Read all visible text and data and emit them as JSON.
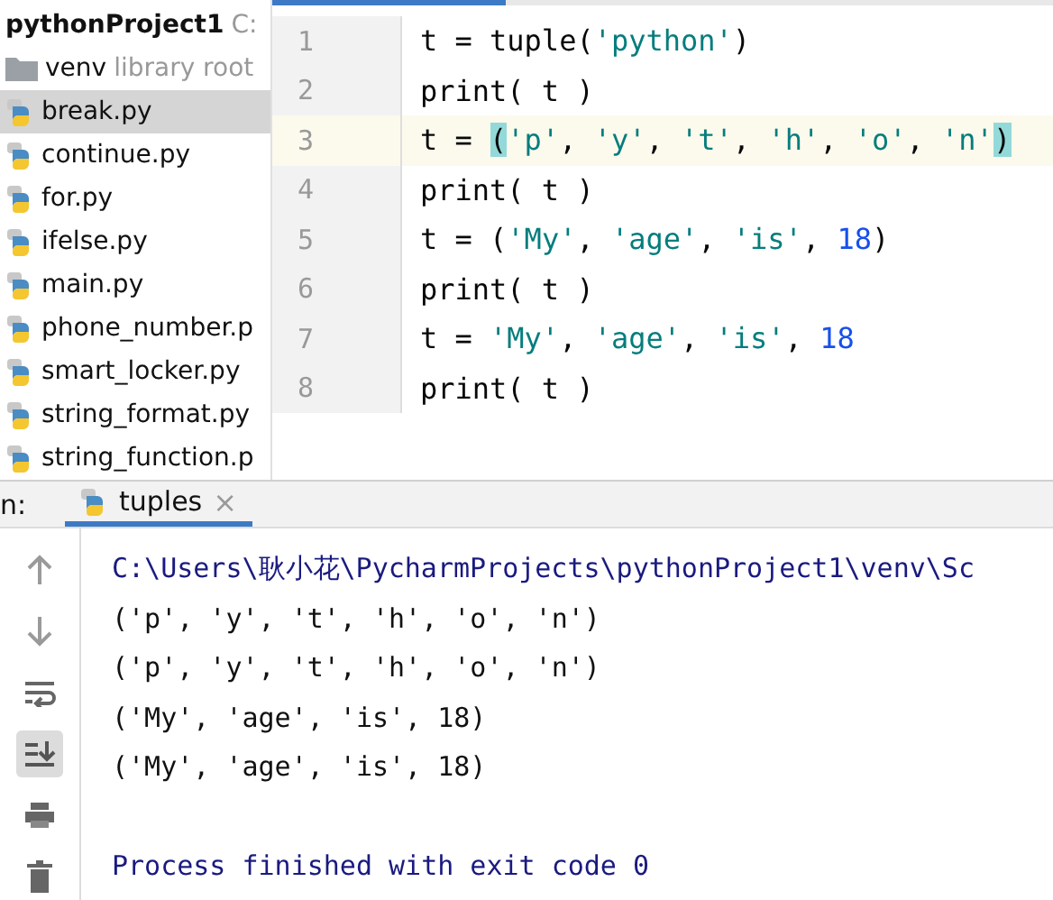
{
  "project": {
    "root": {
      "name": "pythonProject1",
      "path": "C:"
    },
    "items": [
      {
        "kind": "folder",
        "name": "venv",
        "note": "library root",
        "selected": false
      },
      {
        "kind": "file",
        "name": "break.py",
        "selected": true
      },
      {
        "kind": "file",
        "name": "continue.py",
        "selected": false
      },
      {
        "kind": "file",
        "name": "for.py",
        "selected": false
      },
      {
        "kind": "file",
        "name": "ifelse.py",
        "selected": false
      },
      {
        "kind": "file",
        "name": "main.py",
        "selected": false
      },
      {
        "kind": "file",
        "name": "phone_number.p",
        "selected": false
      },
      {
        "kind": "file",
        "name": "smart_locker.py",
        "selected": false
      },
      {
        "kind": "file",
        "name": "string_format.py",
        "selected": false
      },
      {
        "kind": "file",
        "name": "string_function.p",
        "selected": false
      }
    ]
  },
  "editor": {
    "lines": [
      {
        "number": "1",
        "current": false,
        "tokens": [
          {
            "kind": "plain",
            "text": "t = tuple("
          },
          {
            "kind": "string",
            "text": "'python'"
          },
          {
            "kind": "plain",
            "text": ")"
          }
        ]
      },
      {
        "number": "2",
        "current": false,
        "tokens": [
          {
            "kind": "plain",
            "text": "print( t )"
          }
        ]
      },
      {
        "number": "3",
        "current": true,
        "tokens": [
          {
            "kind": "plain",
            "text": "t = "
          },
          {
            "kind": "match",
            "text": "("
          },
          {
            "kind": "string",
            "text": "'p'"
          },
          {
            "kind": "plain",
            "text": ", "
          },
          {
            "kind": "string",
            "text": "'y'"
          },
          {
            "kind": "plain",
            "text": ", "
          },
          {
            "kind": "string",
            "text": "'t'"
          },
          {
            "kind": "plain",
            "text": ", "
          },
          {
            "kind": "string",
            "text": "'h'"
          },
          {
            "kind": "plain",
            "text": ", "
          },
          {
            "kind": "string",
            "text": "'o'"
          },
          {
            "kind": "plain",
            "text": ", "
          },
          {
            "kind": "string",
            "text": "'n'"
          },
          {
            "kind": "match",
            "text": ")"
          }
        ]
      },
      {
        "number": "4",
        "current": false,
        "tokens": [
          {
            "kind": "plain",
            "text": "print( t )"
          }
        ]
      },
      {
        "number": "5",
        "current": false,
        "tokens": [
          {
            "kind": "plain",
            "text": "t = ("
          },
          {
            "kind": "string",
            "text": "'My'"
          },
          {
            "kind": "plain",
            "text": ", "
          },
          {
            "kind": "string",
            "text": "'age'"
          },
          {
            "kind": "plain",
            "text": ", "
          },
          {
            "kind": "string",
            "text": "'is'"
          },
          {
            "kind": "plain",
            "text": ", "
          },
          {
            "kind": "number",
            "text": "18"
          },
          {
            "kind": "plain",
            "text": ")"
          }
        ]
      },
      {
        "number": "6",
        "current": false,
        "tokens": [
          {
            "kind": "plain",
            "text": "print( t )"
          }
        ]
      },
      {
        "number": "7",
        "current": false,
        "tokens": [
          {
            "kind": "plain",
            "text": "t = "
          },
          {
            "kind": "string",
            "text": "'My'"
          },
          {
            "kind": "plain",
            "text": ", "
          },
          {
            "kind": "string",
            "text": "'age'"
          },
          {
            "kind": "plain",
            "text": ", "
          },
          {
            "kind": "string",
            "text": "'is'"
          },
          {
            "kind": "plain",
            "text": ", "
          },
          {
            "kind": "number",
            "text": "18"
          }
        ]
      },
      {
        "number": "8",
        "current": false,
        "tokens": [
          {
            "kind": "plain",
            "text": "print( t )"
          }
        ]
      }
    ]
  },
  "run": {
    "label": "n:",
    "tabs": [
      {
        "title": "tuples",
        "close": "×",
        "selected": true
      }
    ],
    "output": [
      {
        "kind": "command",
        "text": "C:\\Users\\耿小花\\PycharmProjects\\pythonProject1\\venv\\Sc"
      },
      {
        "kind": "stdout",
        "text": "('p', 'y', 't', 'h', 'o', 'n')"
      },
      {
        "kind": "stdout",
        "text": "('p', 'y', 't', 'h', 'o', 'n')"
      },
      {
        "kind": "stdout",
        "text": "('My', 'age', 'is', 18)"
      },
      {
        "kind": "stdout",
        "text": "('My', 'age', 'is', 18)"
      },
      {
        "kind": "blank"
      },
      {
        "kind": "status",
        "text": "Process finished with exit code 0"
      }
    ]
  }
}
